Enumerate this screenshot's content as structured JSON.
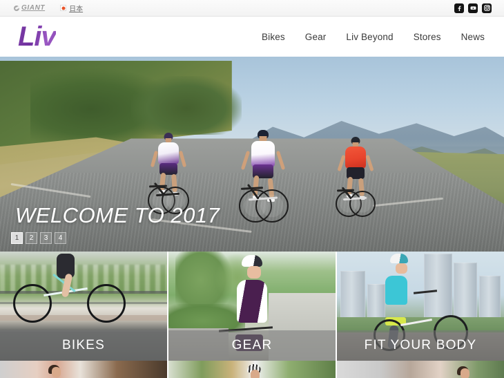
{
  "topbar": {
    "brand_label": "GIANT",
    "brand_icon": "giant-swoosh-icon",
    "language_label": "日本",
    "language_icon": "japan-flag-icon",
    "social": [
      {
        "name": "facebook-icon",
        "label": "f"
      },
      {
        "name": "youtube-icon",
        "label": "▶"
      },
      {
        "name": "instagram-icon",
        "label": "◉"
      }
    ]
  },
  "header": {
    "logo_text": "Liv",
    "nav": [
      {
        "label": "Bikes"
      },
      {
        "label": "Gear"
      },
      {
        "label": "Liv Beyond"
      },
      {
        "label": "Stores"
      },
      {
        "label": "News"
      }
    ]
  },
  "hero": {
    "title": "WELCOME TO 2017",
    "pagination": [
      {
        "label": "1",
        "active": true
      },
      {
        "label": "2",
        "active": false
      },
      {
        "label": "3",
        "active": false
      },
      {
        "label": "4",
        "active": false
      }
    ]
  },
  "tiles": [
    {
      "label": "BIKES"
    },
    {
      "label": "GEAR"
    },
    {
      "label": "FIT YOUR BODY"
    }
  ],
  "colors": {
    "brand_purple": "#7e3fa8",
    "topbar_bg": "#f3f3f3",
    "nav_text": "#3a3a3a",
    "tile_overlay": "rgba(120,120,120,0.55)",
    "flag_red": "#e8542a"
  }
}
